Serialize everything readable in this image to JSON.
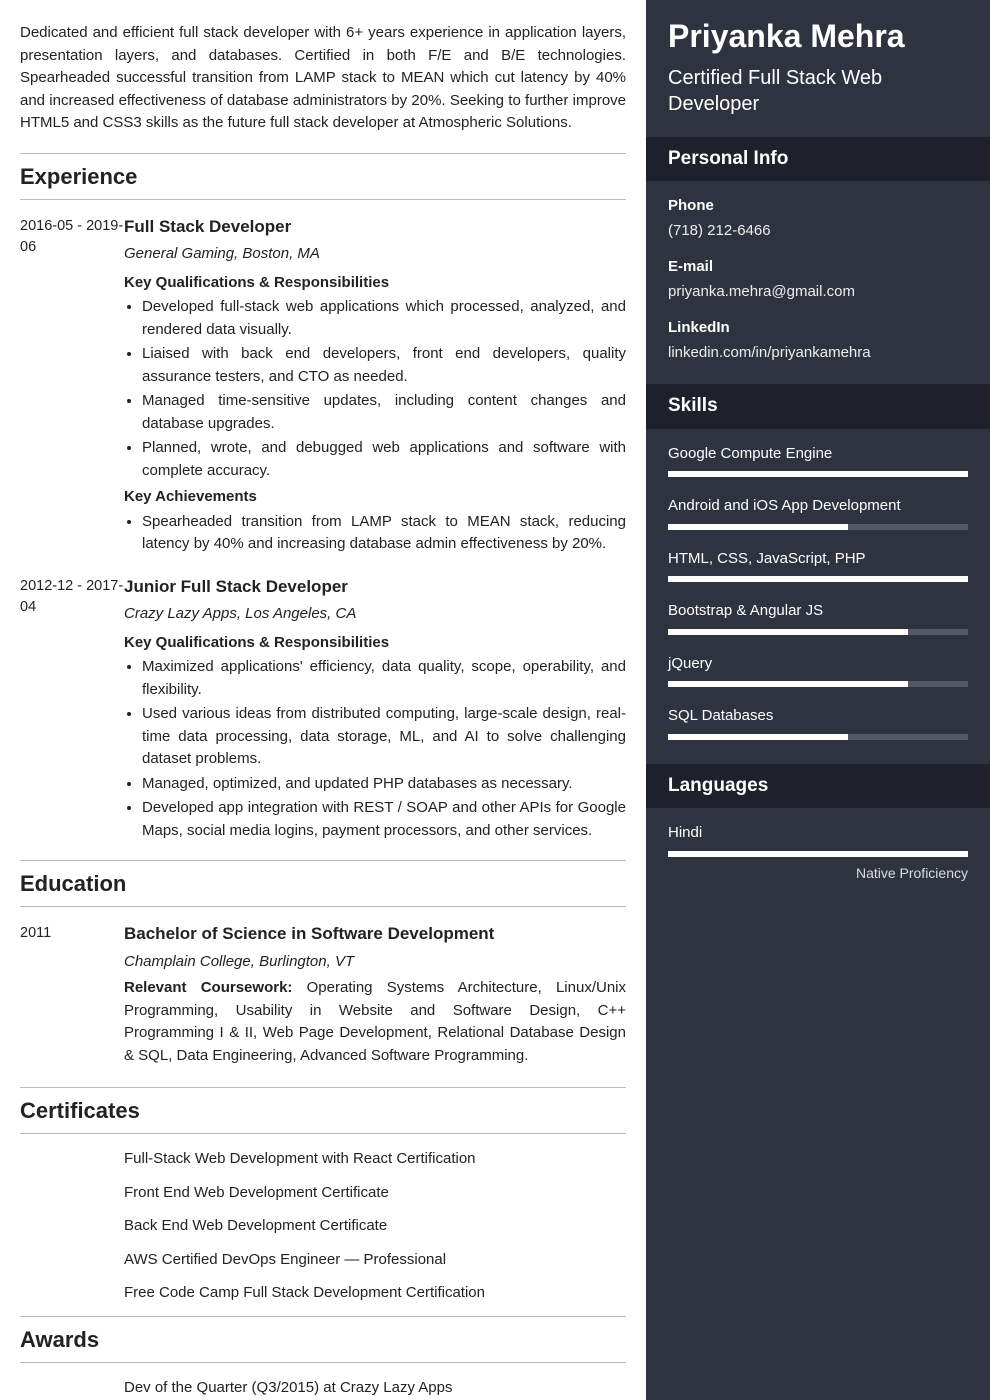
{
  "summary": "Dedicated and efficient full stack developer with 6+ years experience in application layers, presentation layers, and databases. Certified in both F/E and B/E technologies. Spearheaded successful transition from LAMP stack to MEAN which cut latency by 40% and increased effectiveness of database administrators by 20%. Seeking to further improve HTML5 and CSS3 skills as the future full stack developer at Atmospheric Solutions.",
  "sections": {
    "experience": "Experience",
    "education": "Education",
    "certificates": "Certificates",
    "awards": "Awards"
  },
  "experience": [
    {
      "dates": "2016-05 - 2019-06",
      "role": "Full Stack Developer",
      "org": "General Gaming, Boston, MA",
      "resp_heading": "Key Qualifications & Responsibilities",
      "resp": [
        "Developed full-stack web applications which processed, analyzed, and rendered data visually.",
        "Liaised with back end developers, front end developers, quality assurance testers, and CTO as needed.",
        "Managed time-sensitive updates, including content changes and database upgrades.",
        "Planned, wrote, and debugged web applications and software with complete accuracy."
      ],
      "ach_heading": "Key Achievements",
      "ach": [
        "Spearheaded transition from LAMP stack to MEAN stack, reducing latency by 40% and increasing database admin effectiveness by 20%."
      ]
    },
    {
      "dates": "2012-12 - 2017-04",
      "role": "Junior Full Stack Developer",
      "org": "Crazy Lazy Apps, Los Angeles, CA",
      "resp_heading": "Key Qualifications & Responsibilities",
      "resp": [
        "Maximized applications' efficiency, data quality, scope, operability, and flexibility.",
        "Used various ideas from distributed computing, large-scale design, real-time data processing, data storage, ML, and AI to solve challenging dataset problems.",
        "Managed, optimized, and updated PHP databases as necessary.",
        "Developed app integration with REST / SOAP and other APIs for Google Maps, social media logins, payment processors, and other services."
      ]
    }
  ],
  "education": {
    "dates": "2011",
    "degree": "Bachelor of Science in Software Development",
    "school": "Champlain College, Burlington, VT",
    "coursework_label": "Relevant Coursework:",
    "coursework": "Operating Systems Architecture, Linux/Unix Programming, Usability in Website and Software Design, C++ Programming I & II, Web Page Development, Relational Database Design & SQL, Data Engineering, Advanced Software Programming."
  },
  "certificates": [
    "Full-Stack Web Development with React Certification",
    "Front End Web Development Certificate",
    "Back End Web Development Certificate",
    "AWS Certified DevOps Engineer — Professional",
    "Free Code Camp Full Stack Development Certification"
  ],
  "awards": [
    "Dev of the Quarter (Q3/2015) at Crazy Lazy Apps"
  ],
  "sidebar": {
    "name": "Priyanka Mehra",
    "title": "Certified Full Stack Web Developer",
    "sections": {
      "personal": "Personal Info",
      "skills": "Skills",
      "languages": "Languages"
    },
    "personal": [
      {
        "label": "Phone",
        "value": "(718) 212-6466"
      },
      {
        "label": "E-mail",
        "value": "priyanka.mehra@gmail.com"
      },
      {
        "label": "LinkedIn",
        "value": "linkedin.com/in/priyankamehra"
      }
    ],
    "skills": [
      {
        "name": "Google Compute Engine",
        "level": 100
      },
      {
        "name": "Android and iOS App Development",
        "level": 60
      },
      {
        "name": "HTML, CSS, JavaScript, PHP",
        "level": 100
      },
      {
        "name": "Bootstrap & Angular JS",
        "level": 80
      },
      {
        "name": "jQuery",
        "level": 80
      },
      {
        "name": "SQL Databases",
        "level": 60
      }
    ],
    "languages": [
      {
        "name": "Hindi",
        "level": 100,
        "label": "Native Proficiency"
      }
    ]
  }
}
